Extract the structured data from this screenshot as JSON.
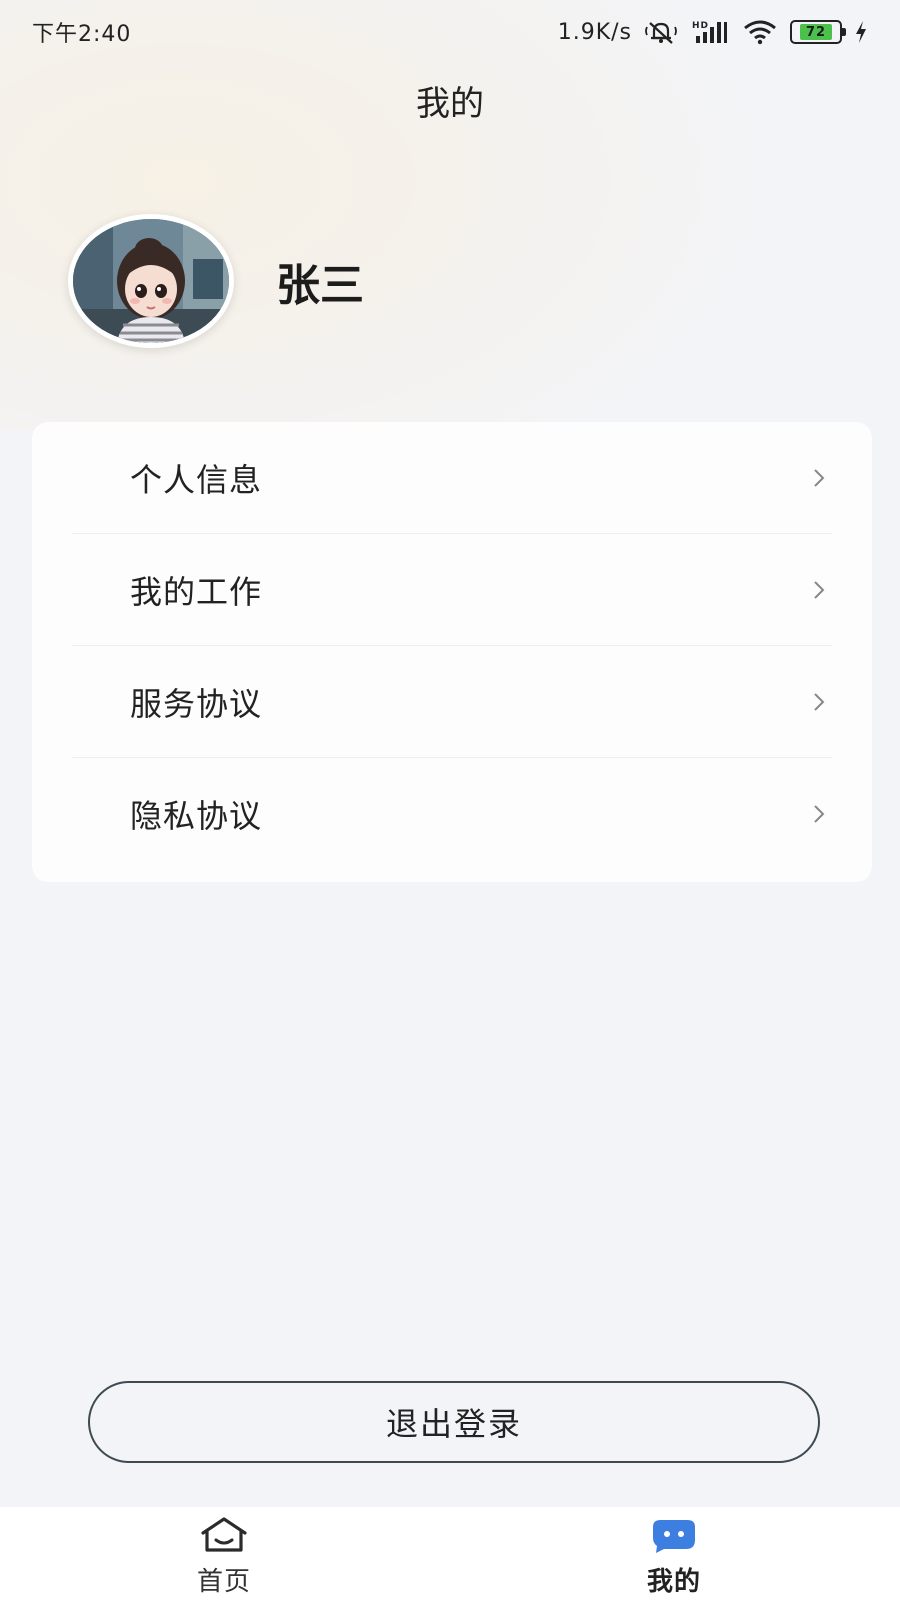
{
  "status_bar": {
    "time": "下午2:40",
    "network_speed": "1.9K/s",
    "signal_label": "HD",
    "battery_level": "72",
    "battery_percent": 72
  },
  "header": {
    "title": "我的"
  },
  "profile": {
    "name": "张三"
  },
  "menu": {
    "items": [
      {
        "label": "个人信息"
      },
      {
        "label": "我的工作"
      },
      {
        "label": "服务协议"
      },
      {
        "label": "隐私协议"
      }
    ]
  },
  "logout": {
    "label": "退出登录"
  },
  "tabbar": {
    "tabs": [
      {
        "label": "首页",
        "icon": "home-icon",
        "active": false
      },
      {
        "label": "我的",
        "icon": "profile-chat-icon",
        "active": true
      }
    ]
  },
  "colors": {
    "accent": "#3d7fe0",
    "battery_fill": "#4cc04c",
    "background": "#f3f4f8"
  }
}
